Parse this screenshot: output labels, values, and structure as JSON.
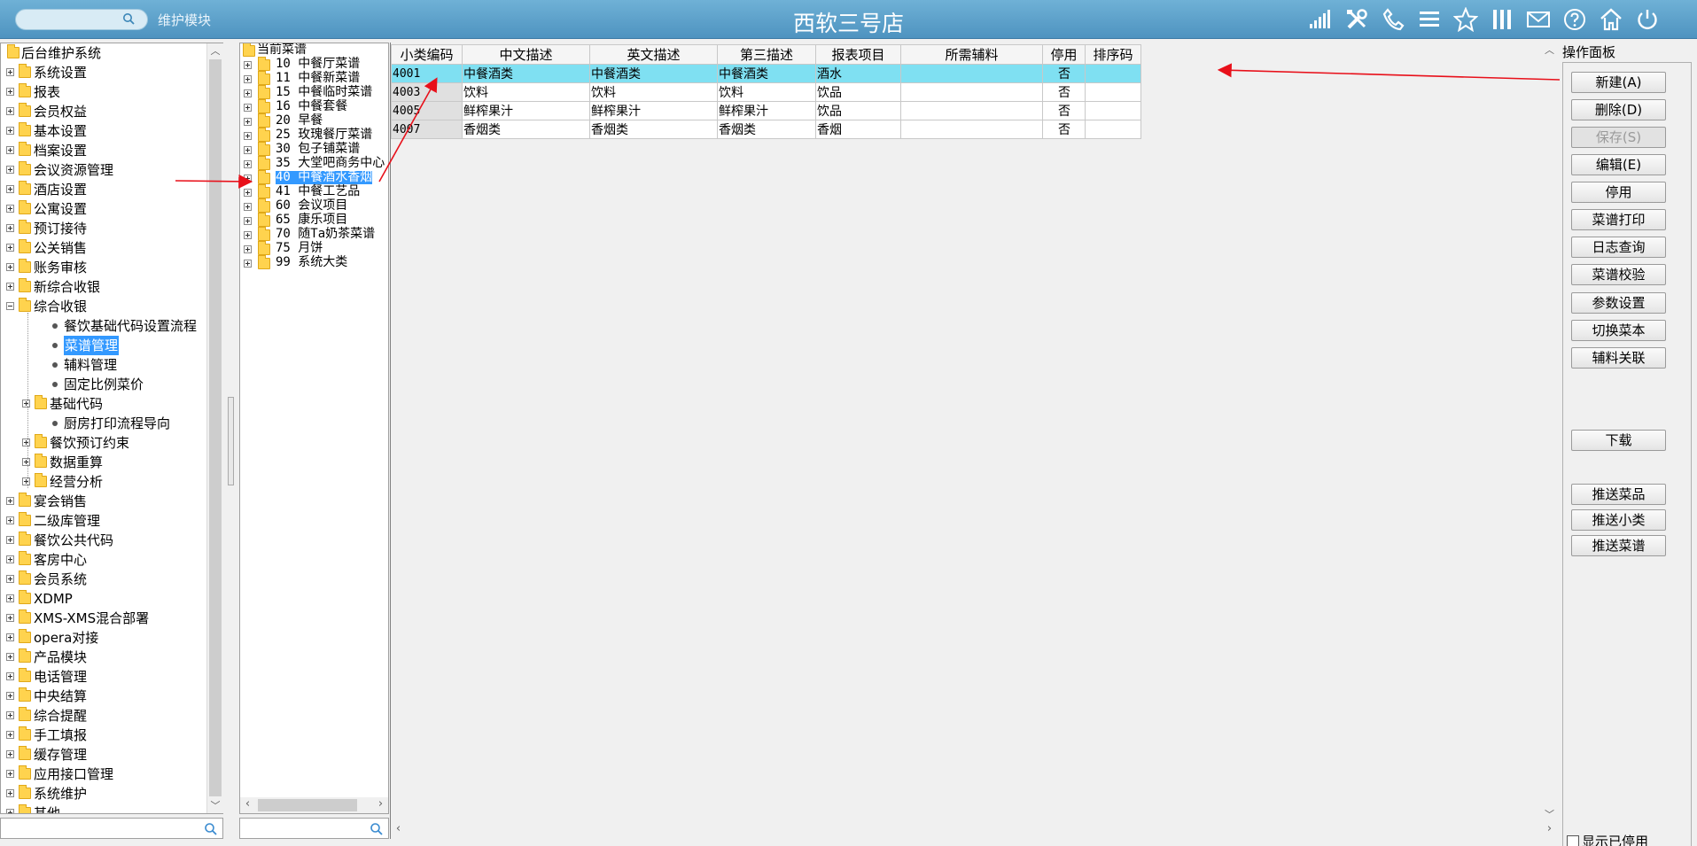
{
  "header": {
    "module_label": "维护模块",
    "app_title": "西软三号店",
    "icons": [
      "signal-icon",
      "tools-icon",
      "phone-icon",
      "menu-icon",
      "star-icon",
      "columns-icon",
      "mail-icon",
      "help-icon",
      "home-icon",
      "power-icon"
    ]
  },
  "nav": {
    "root": "后台维护系统",
    "items": [
      {
        "label": "系统设置"
      },
      {
        "label": "报表"
      },
      {
        "label": "会员权益"
      },
      {
        "label": "基本设置"
      },
      {
        "label": "档案设置"
      },
      {
        "label": "会议资源管理"
      },
      {
        "label": "酒店设置"
      },
      {
        "label": "公寓设置"
      },
      {
        "label": "预订接待"
      },
      {
        "label": "公关销售"
      },
      {
        "label": "账务审核"
      },
      {
        "label": "新综合收银"
      },
      {
        "label": "综合收银"
      }
    ],
    "sub_items": [
      {
        "label": "餐饮基础代码设置流程"
      },
      {
        "label": "菜谱管理"
      },
      {
        "label": "辅料管理"
      },
      {
        "label": "固定比例菜价"
      },
      {
        "label": "基础代码"
      },
      {
        "label": "厨房打印流程导向"
      },
      {
        "label": "餐饮预订约束"
      },
      {
        "label": "数据重算"
      },
      {
        "label": "经营分析"
      }
    ],
    "items_after": [
      {
        "label": "宴会销售"
      },
      {
        "label": "二级库管理"
      },
      {
        "label": "餐饮公共代码"
      },
      {
        "label": "客房中心"
      },
      {
        "label": "会员系统"
      },
      {
        "label": "XDMP"
      },
      {
        "label": "XMS-XMS混合部署"
      },
      {
        "label": "opera对接"
      },
      {
        "label": "产品模块"
      },
      {
        "label": "电话管理"
      },
      {
        "label": "中央结算"
      },
      {
        "label": "综合提醒"
      },
      {
        "label": "手工填报"
      },
      {
        "label": "缓存管理"
      },
      {
        "label": "应用接口管理"
      },
      {
        "label": "系统维护"
      },
      {
        "label": "其他"
      }
    ]
  },
  "categories": {
    "root": "当前菜谱",
    "items": [
      {
        "label": "10  中餐厅菜谱"
      },
      {
        "label": "11  中餐新菜谱"
      },
      {
        "label": "15  中餐临时菜谱"
      },
      {
        "label": "16  中餐套餐"
      },
      {
        "label": "20  早餐"
      },
      {
        "label": "25  玫瑰餐厅菜谱"
      },
      {
        "label": "30  包子铺菜谱"
      },
      {
        "label": "35  大堂吧商务中心"
      },
      {
        "label": "40  中餐酒水香烟"
      },
      {
        "label": "41  中餐工艺品"
      },
      {
        "label": "60  会议项目"
      },
      {
        "label": "65  康乐项目"
      },
      {
        "label": "70  随Ta奶茶菜谱"
      },
      {
        "label": "75  月饼"
      },
      {
        "label": "99  系统大类"
      }
    ]
  },
  "grid": {
    "columns": [
      "小类编码",
      "中文描述",
      "英文描述",
      "第三描述",
      "报表项目",
      "所需辅料",
      "停用",
      "排序码"
    ],
    "rows": [
      {
        "code": "4001",
        "zh": "中餐酒类",
        "en": "中餐酒类",
        "third": "中餐酒类",
        "report": "酒水",
        "aux": "",
        "disabled": "否",
        "sort": ""
      },
      {
        "code": "4003",
        "zh": "饮料",
        "en": "饮料",
        "third": "饮料",
        "report": "饮品",
        "aux": "",
        "disabled": "否",
        "sort": ""
      },
      {
        "code": "4005",
        "zh": "鲜榨果汁",
        "en": "鲜榨果汁",
        "third": "鲜榨果汁",
        "report": "饮品",
        "aux": "",
        "disabled": "否",
        "sort": ""
      },
      {
        "code": "4007",
        "zh": "香烟类",
        "en": "香烟类",
        "third": "香烟类",
        "report": "香烟",
        "aux": "",
        "disabled": "否",
        "sort": ""
      }
    ]
  },
  "ops": {
    "title": "操作面板",
    "buttons": [
      {
        "label": "新建(A)"
      },
      {
        "label": "删除(D)"
      },
      {
        "label": "保存(S)"
      },
      {
        "label": "编辑(E)"
      },
      {
        "label": "停用"
      },
      {
        "label": "菜谱打印"
      },
      {
        "label": "日志查询"
      },
      {
        "label": "菜谱校验"
      },
      {
        "label": "参数设置"
      },
      {
        "label": "切换菜本"
      },
      {
        "label": "辅料关联"
      },
      {
        "label": "下载"
      },
      {
        "label": "推送菜品"
      },
      {
        "label": "推送小类"
      },
      {
        "label": "推送菜谱"
      }
    ],
    "show_disabled": "显示已停用"
  },
  "colors": {
    "titlebar": "#5aa0cc",
    "selection": "#3399ff",
    "grid_selected": "#7fe0f2",
    "arrow": "#e8101a"
  }
}
